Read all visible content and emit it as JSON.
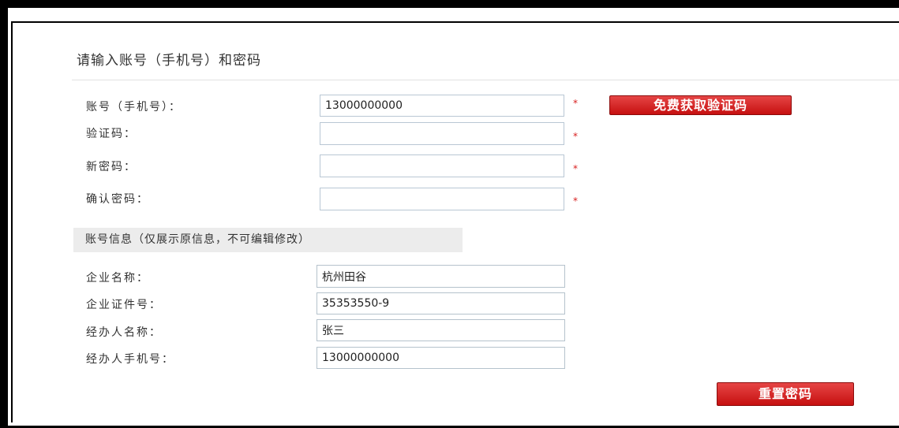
{
  "section_title": "请输入账号（手机号）和密码",
  "required_mark": "*",
  "form": {
    "account_label": "账号（手机号）：",
    "account_value": "13000000000",
    "get_code_button": "免费获取验证码",
    "code_label": "验证码：",
    "code_value": "",
    "new_password_label": "新密码：",
    "new_password_value": "",
    "confirm_password_label": "确认密码：",
    "confirm_password_value": ""
  },
  "account_info": {
    "header": "账号信息（仅展示原信息，不可编辑修改）",
    "company_name_label": "企业名称：",
    "company_name_value": "杭州田谷",
    "company_cert_label": "企业证件号：",
    "company_cert_value": "35353550-9",
    "agent_name_label": "经办人名称：",
    "agent_name_value": "张三",
    "agent_phone_label": "经办人手机号：",
    "agent_phone_value": "13000000000"
  },
  "reset_button": "重置密码",
  "colors": {
    "button_red": "#d42424",
    "required_star": "#d82020",
    "input_border": "#b9c7d4"
  }
}
